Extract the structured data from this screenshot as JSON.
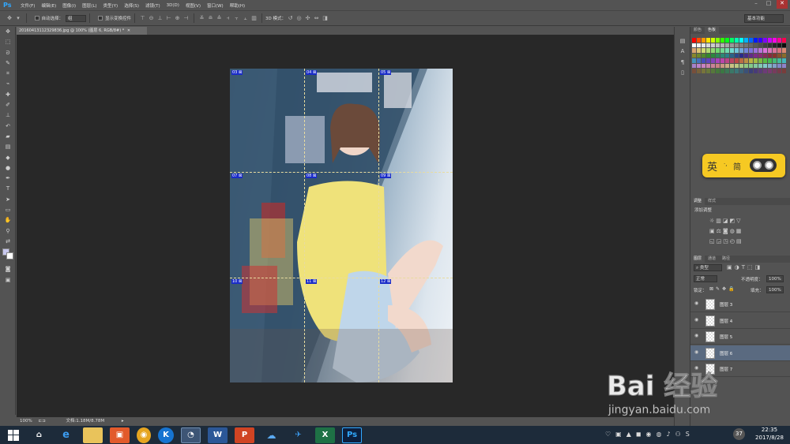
{
  "app": {
    "logo": "Ps"
  },
  "menu": [
    "文件(F)",
    "编辑(E)",
    "图像(I)",
    "图层(L)",
    "类型(Y)",
    "选择(S)",
    "滤镜(T)",
    "3D(D)",
    "视图(V)",
    "窗口(W)",
    "帮助(H)"
  ],
  "options": {
    "auto_select_label": "自动选择：",
    "auto_select_value": "组",
    "show_transform_label": "显示变换控件",
    "mode_3d_label": "3D 模式：",
    "workspace": "基本功能"
  },
  "document": {
    "tab_title": "20160413112329836.jpg @ 100% (图层 6, RGB/8#) *"
  },
  "slices": [
    {
      "label": "03",
      "tag": "⊠"
    },
    {
      "label": "04",
      "tag": "⊠"
    },
    {
      "label": "05",
      "tag": "⊠"
    },
    {
      "label": "07",
      "tag": "⊠"
    },
    {
      "label": "08",
      "tag": "⊠"
    },
    {
      "label": "09",
      "tag": "⊠"
    },
    {
      "label": "10",
      "tag": "⊠"
    },
    {
      "label": "11",
      "tag": "⊠"
    },
    {
      "label": "12",
      "tag": "⊠"
    }
  ],
  "status": {
    "zoom": "100%",
    "doc_info": "文档:1.18M/8.78M"
  },
  "panels": {
    "swatch_tabs": [
      "颜色",
      "色板"
    ],
    "style_tabs": [
      "调整",
      "样式"
    ],
    "adjust_title": "添加调整",
    "layer_tabs": [
      "图层",
      "通道",
      "路径"
    ],
    "filter_kind": "类型",
    "blend_mode": "正常",
    "opacity_label": "不透明度：",
    "opacity_value": "100%",
    "lock_label": "锁定：",
    "fill_label": "填充：",
    "fill_value": "100%",
    "layers": [
      {
        "name": "图层 3",
        "selected": false
      },
      {
        "name": "图层 4",
        "selected": false
      },
      {
        "name": "图层 5",
        "selected": false
      },
      {
        "name": "图层 6",
        "selected": true
      },
      {
        "name": "图层 7",
        "selected": false
      }
    ]
  },
  "ime": {
    "char1": "英",
    "sep": "·,",
    "char2": "简"
  },
  "watermark": {
    "logo": "Bai 经验",
    "url": "jingyan.baidu.com"
  },
  "taskbar": {
    "icons": [
      "home",
      "ie",
      "explorer",
      "ppt-red",
      "coin",
      "k-app",
      "browser",
      "word",
      "powerpoint",
      "cloud",
      "bird",
      "excel",
      "photoshop"
    ],
    "labels": {
      "word": "W",
      "powerpoint": "P",
      "excel": "X",
      "photoshop": "Ps",
      "k-app": "K"
    },
    "time": "22:35",
    "date": "2017/8/28",
    "tray_badge": "37"
  },
  "colors": {
    "accent": "#31a8ff",
    "taskbar": "#1d2b3a",
    "ime_yellow": "#f6c923"
  }
}
